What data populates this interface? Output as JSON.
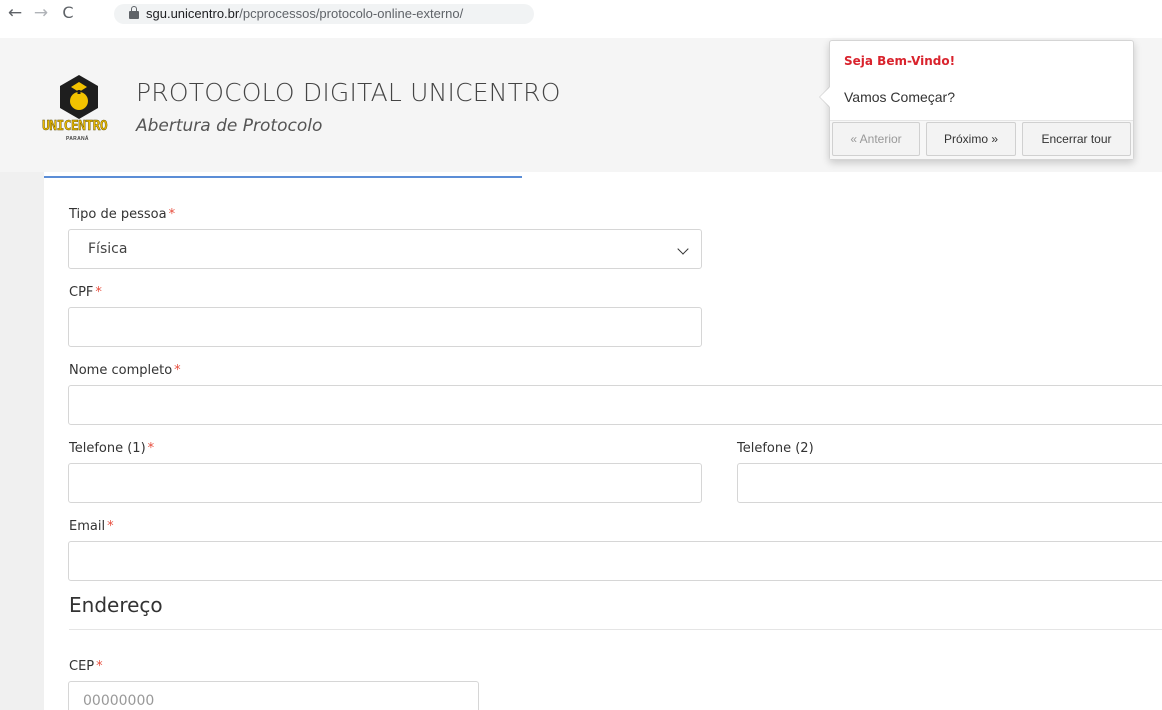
{
  "browser": {
    "back_glyph": "←",
    "forward_glyph": "→",
    "reload_glyph": "C",
    "url_host": "sgu.unicentro.br",
    "url_path": "/pcprocessos/protocolo-online-externo/"
  },
  "logo": {
    "wordmark": "UNICENTRO",
    "subline": "PARANÁ",
    "colors": {
      "yellow": "#e8b800",
      "dark": "#222222"
    }
  },
  "header": {
    "title": "PROTOCOLO DIGITAL UNICENTRO",
    "subtitle": "Abertura de Protocolo"
  },
  "tour": {
    "title": "Seja Bem-Vindo!",
    "content": "Vamos Começar?",
    "prev_label": "« Anterior",
    "next_label": "Próximo »",
    "end_label": "Encerrar tour",
    "title_color": "#d9232d"
  },
  "form": {
    "required_mark": "*",
    "tipo_pessoa": {
      "label": "Tipo de pessoa",
      "value": "Física"
    },
    "cpf": {
      "label": "CPF",
      "value": ""
    },
    "nome": {
      "label": "Nome completo",
      "value": ""
    },
    "telefone1": {
      "label": "Telefone (1)",
      "value": ""
    },
    "telefone2": {
      "label": "Telefone (2)",
      "value": ""
    },
    "email": {
      "label": "Email",
      "value": ""
    },
    "endereco_title": "Endereço",
    "cep": {
      "label": "CEP",
      "placeholder": "00000000"
    }
  },
  "theme": {
    "accent": "#5b8dd6",
    "required": "#e74c3c"
  }
}
